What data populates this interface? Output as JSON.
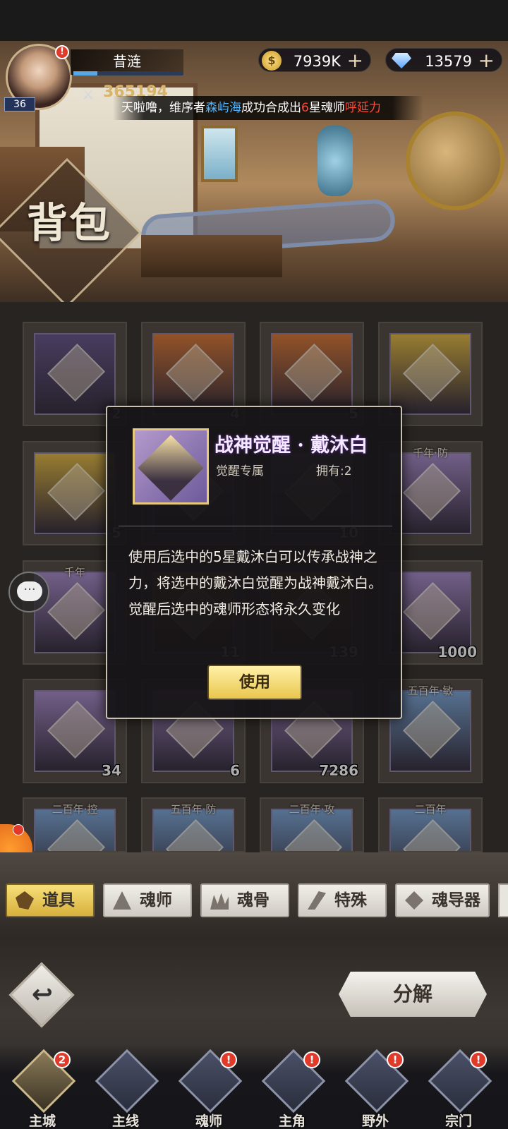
{
  "player": {
    "level": "36",
    "name": "昔涟",
    "power": "365194",
    "exp_fraction": 0.22
  },
  "currencies": [
    {
      "icon": "gold-coin-icon",
      "value": "7939K",
      "plus": "+"
    },
    {
      "icon": "diamond-icon",
      "value": "13579",
      "plus": "+"
    }
  ],
  "marquee": {
    "prefix": "天啦噜，维序者",
    "player_name": "森屿海",
    "middle": "成功合成出",
    "star": "6",
    "star_suffix": "星魂师",
    "hero_name": "呼延力"
  },
  "page_title": "背包",
  "grid": [
    {
      "count": "2",
      "tag": "",
      "color": "#6b5a8c"
    },
    {
      "count": "4",
      "tag": "",
      "color": "#d77a3c"
    },
    {
      "count": "5",
      "tag": "",
      "color": "#d77a3c"
    },
    {
      "count": "",
      "tag": "",
      "color": "#e0b84a"
    },
    {
      "count": "5",
      "tag": "",
      "color": "#e0b84a"
    },
    {
      "count": "",
      "tag": "",
      "color": "#a88cc8"
    },
    {
      "count": "10",
      "tag": "",
      "color": "#a88cc8"
    },
    {
      "count": "",
      "tag": "千年·防",
      "color": "#a88cc8"
    },
    {
      "count": "",
      "tag": "千年",
      "color": "#a88cc8"
    },
    {
      "count": "11",
      "tag": "",
      "color": "#d77a3c"
    },
    {
      "count": "139",
      "tag": "",
      "color": "#d77a3c"
    },
    {
      "count": "1000",
      "tag": "",
      "color": "#a88cc8"
    },
    {
      "count": "34",
      "tag": "",
      "color": "#a88cc8"
    },
    {
      "count": "6",
      "tag": "",
      "color": "#a88cc8"
    },
    {
      "count": "7286",
      "tag": "",
      "color": "#a88cc8"
    },
    {
      "count": "",
      "tag": "五百年·敏",
      "color": "#7fa6d4"
    },
    {
      "count": "",
      "tag": "二百年·控",
      "color": "#7fa6d4"
    },
    {
      "count": "",
      "tag": "五百年·防",
      "color": "#7fa6d4"
    },
    {
      "count": "",
      "tag": "二百年·攻",
      "color": "#7fa6d4"
    },
    {
      "count": "",
      "tag": "二百年",
      "color": "#7fa6d4"
    }
  ],
  "popup": {
    "title": "战神觉醒 · 戴沐白",
    "subtitle": "觉醒专属",
    "owned": "拥有:2",
    "description": "使用后选中的5星戴沐白可以传承战神之力，将选中的戴沐白觉醒为战神戴沐白。觉醒后选中的魂师形态将永久变化",
    "use_label": "使用"
  },
  "tabs": [
    {
      "label": "道具",
      "active": true
    },
    {
      "label": "魂师",
      "active": false
    },
    {
      "label": "魂骨",
      "active": false
    },
    {
      "label": "特殊",
      "active": false
    },
    {
      "label": "魂导器",
      "active": false
    }
  ],
  "decompose_label": "分解",
  "nav": [
    {
      "label": "主城",
      "badge": "2",
      "icon": "castle-icon"
    },
    {
      "label": "主线",
      "badge": "",
      "icon": "mainline-icon"
    },
    {
      "label": "魂师",
      "badge": "!",
      "icon": "book-icon"
    },
    {
      "label": "主角",
      "badge": "!",
      "icon": "hero-icon"
    },
    {
      "label": "野外",
      "badge": "!",
      "icon": "sword-icon"
    },
    {
      "label": "宗门",
      "badge": "!",
      "icon": "sect-icon"
    }
  ],
  "colors": {
    "marquee_blue": "#4fb6ff",
    "marquee_red": "#ff4a3a",
    "active_tab": "#e8c44e"
  }
}
